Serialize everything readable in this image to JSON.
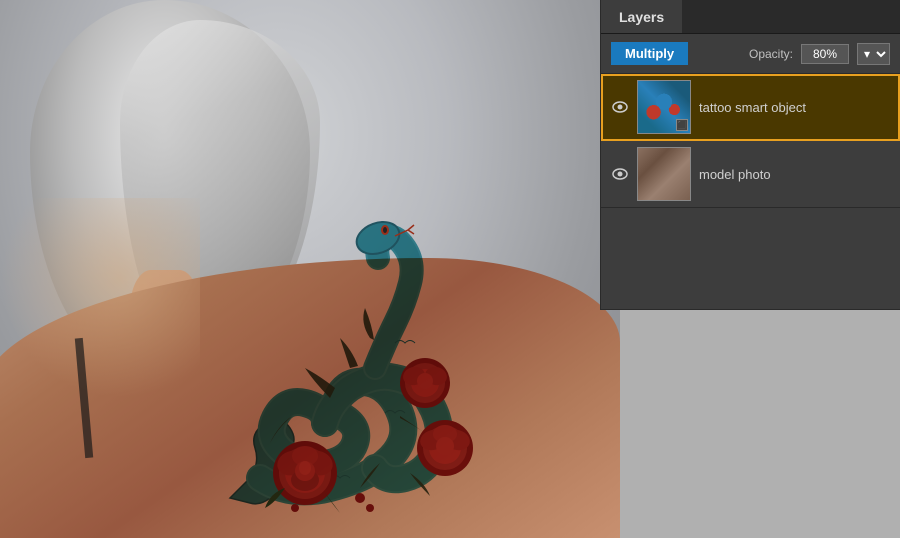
{
  "panel": {
    "title": "Layers",
    "blend_mode": "Multiply",
    "opacity_label": "Opacity:",
    "opacity_value": "80%",
    "layers": [
      {
        "id": "tattoo-layer",
        "name": "tattoo smart object",
        "selected": true,
        "visible": true,
        "thumbnail_type": "tattoo"
      },
      {
        "id": "model-layer",
        "name": "model photo",
        "selected": false,
        "visible": true,
        "thumbnail_type": "model"
      }
    ]
  }
}
